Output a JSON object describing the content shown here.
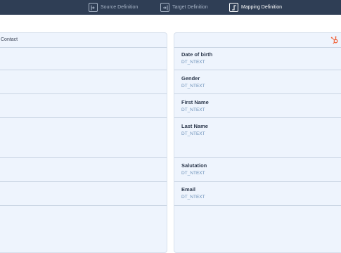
{
  "steps": [
    {
      "label": "Source Definition",
      "icon": "source-definition-icon"
    },
    {
      "label": "Target Definition",
      "icon": "target-definition-icon"
    },
    {
      "label": "Mapping Definition",
      "icon": "mapping-definition-icon",
      "active": true
    }
  ],
  "left_panel": {
    "title": "Contact"
  },
  "right_panel": {
    "brand_icon": "hubspot-icon",
    "fields": [
      {
        "name": "Date of birth",
        "type": "DT_NTEXT"
      },
      {
        "name": "Gender",
        "type": "DT_NTEXT"
      },
      {
        "name": "First Name",
        "type": "DT_NTEXT"
      },
      {
        "name": "Last Name",
        "type": "DT_NTEXT"
      },
      {
        "name": "Salutation",
        "type": "DT_NTEXT"
      },
      {
        "name": "Email",
        "type": "DT_NTEXT"
      }
    ]
  },
  "colors": {
    "topbar": "#2f3e55",
    "panel_bg": "#eef4fd",
    "divider": "#c9d4e3",
    "type_text": "#6a8fb8",
    "brand_orange": "#f0653c"
  }
}
